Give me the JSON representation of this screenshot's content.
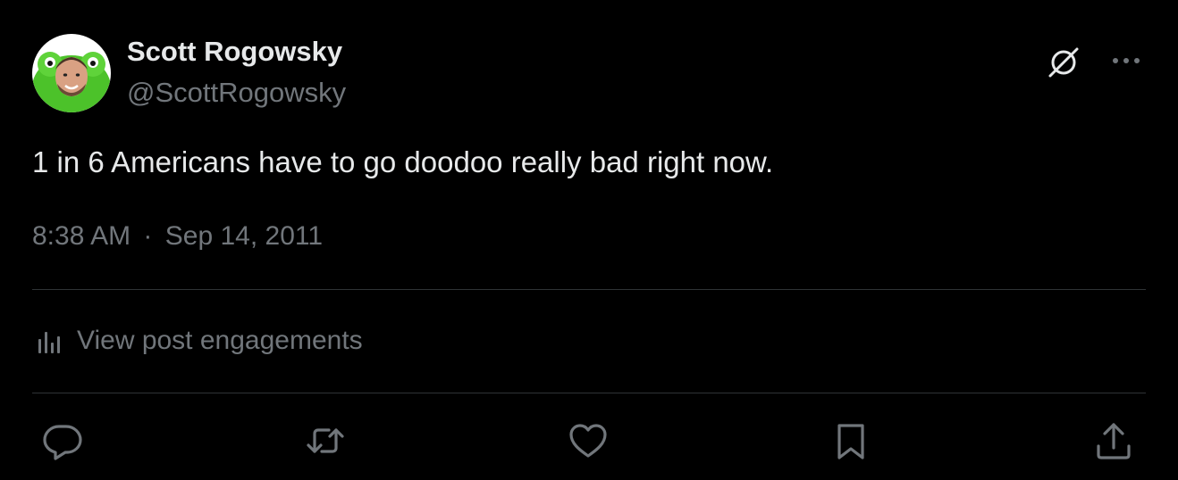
{
  "post": {
    "author": {
      "display_name": "Scott Rogowsky",
      "handle": "@ScottRogowsky",
      "avatar_icon": "avatar-photo"
    },
    "text": "1 in 6 Americans have to go doodoo really bad right now.",
    "time": "8:38 AM",
    "separator": "·",
    "date": "Sep 14, 2011"
  },
  "header_icons": [
    "grok-icon",
    "more-icon"
  ],
  "engagements": {
    "label": "View post engagements",
    "icon": "analytics-icon"
  },
  "actions": [
    {
      "name": "reply",
      "icon": "reply-icon"
    },
    {
      "name": "repost",
      "icon": "repost-icon"
    },
    {
      "name": "like",
      "icon": "heart-icon"
    },
    {
      "name": "bookmark",
      "icon": "bookmark-icon"
    },
    {
      "name": "share",
      "icon": "share-icon"
    }
  ],
  "colors": {
    "background": "#000000",
    "primary_text": "#e7e9ea",
    "secondary_text": "#71767b",
    "divider": "#2f3336",
    "avatar_accent": "#5fd33a"
  }
}
